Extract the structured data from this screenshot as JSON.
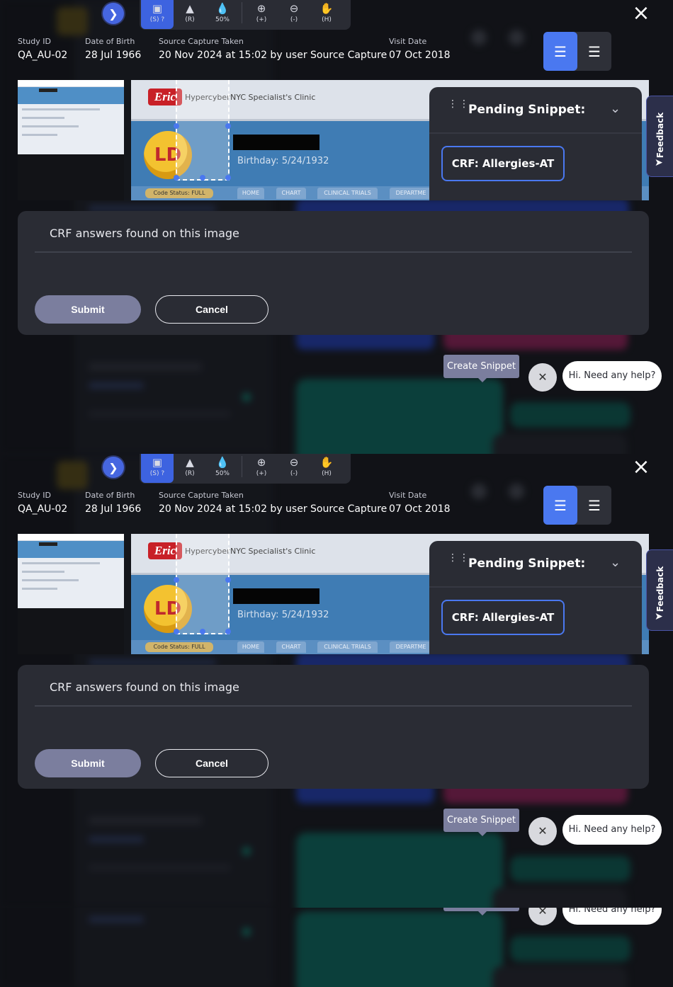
{
  "toolbar": {
    "tools": [
      {
        "icon": "crop-icon",
        "label": "(S)",
        "help": "?"
      },
      {
        "icon": "redact-icon",
        "label": "(R)"
      },
      {
        "icon": "opacity-icon",
        "label": "50%"
      },
      {
        "icon": "zoom-in-icon",
        "label": "(+)"
      },
      {
        "icon": "zoom-out-icon",
        "label": "(-)"
      },
      {
        "icon": "hand-icon",
        "label": "(H)"
      }
    ]
  },
  "meta": {
    "study_id_label": "Study ID",
    "study_id": "QA_AU-02",
    "dob_label": "Date of Birth",
    "dob": "28 Jul 1966",
    "capture_label": "Source Capture Taken",
    "capture": "20 Nov 2024 at 15:02 by user Source Capture",
    "visit_label": "Visit Date",
    "visit": "07 Oct 2018"
  },
  "preview": {
    "logo": "Eric",
    "brand": "Hypercyber",
    "clinic": "NYC Specialist's Clinic",
    "badge": "LD",
    "birthday": "Birthday:   5/24/1932",
    "code_status": "Code Status: FULL",
    "tabs": [
      "HOME",
      "CHART",
      "CLINICAL TRIALS",
      "DEPARTME"
    ]
  },
  "pending": {
    "title": "Pending Snippet:",
    "crf": "CRF: Allergies-AT"
  },
  "feedback": "Feedback",
  "answers": {
    "label": "CRF answers found on this image",
    "submit": "Submit",
    "cancel": "Cancel"
  },
  "tooltip": "Create Snippet",
  "help": "Hi. Need any help?",
  "colors": {
    "accent": "#4a78f0",
    "panel": "#2a2c34",
    "submit": "#7b7e9e"
  }
}
